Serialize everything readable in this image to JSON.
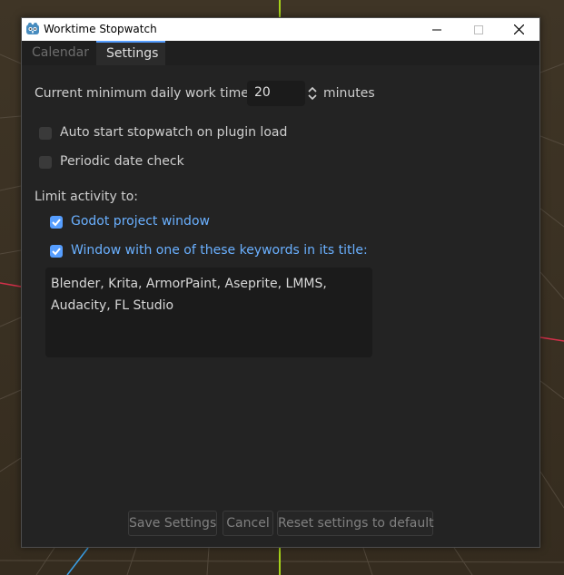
{
  "window": {
    "title": "Worktime Stopwatch"
  },
  "tabs": [
    {
      "label": "Calendar",
      "active": false
    },
    {
      "label": "Settings",
      "active": true
    }
  ],
  "settings": {
    "min_work_label": "Current minimum daily work time:",
    "min_work_value": "20",
    "min_work_unit": "minutes",
    "auto_start_label": "Auto start stopwatch on plugin load",
    "auto_start_checked": false,
    "periodic_check_label": "Periodic date check",
    "periodic_check_checked": false,
    "limit_label": "Limit activity to:",
    "godot_window_label": "Godot project window",
    "godot_window_checked": true,
    "keyword_window_label": "Window with one of these keywords in its title:",
    "keyword_window_checked": true,
    "keywords": "Blender, Krita, ArmorPaint, Aseprite, LMMS,\nAudacity, FL Studio"
  },
  "buttons": {
    "save": "Save Settings",
    "cancel": "Cancel",
    "reset": "Reset settings to default"
  },
  "colors": {
    "accent": "#569eff",
    "panel": "#232323",
    "text": "#cfcfcf",
    "checked_label": "#6ab0ff"
  },
  "icons": {
    "app": "godot-icon",
    "minimize": "minimize-icon",
    "maximize": "maximize-icon",
    "close": "close-icon",
    "spin": "spin-arrows-icon",
    "check": "checkmark-icon"
  }
}
